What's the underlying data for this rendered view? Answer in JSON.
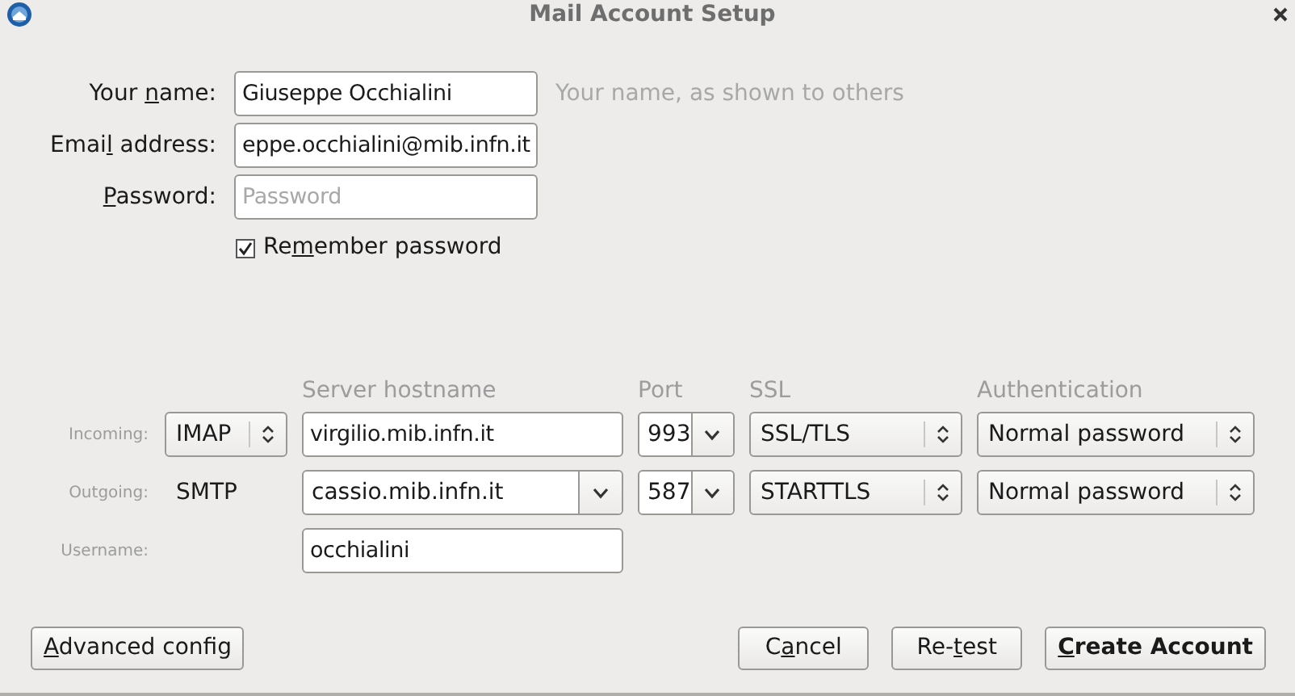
{
  "window": {
    "title": "Mail Account Setup"
  },
  "identity": [
    {
      "label": {
        "before": "Your ",
        "key": "n",
        "after": "ame:"
      },
      "value": "Giuseppe Occhialini",
      "hint": "Your name, as shown to others"
    },
    {
      "label": {
        "before": "Emai",
        "key": "l",
        "after": " address:"
      },
      "value": "eppe.occhialini@mib.infn.it"
    },
    {
      "label": {
        "key": "P",
        "after": "assword:"
      },
      "placeholder": "Password"
    }
  ],
  "remember_password": {
    "label": {
      "before": "Re",
      "key": "m",
      "after": "ember password"
    },
    "checked": true
  },
  "server_columns": [
    "Server hostname",
    "Port",
    "SSL",
    "Authentication"
  ],
  "servers": [
    {
      "label": "Incoming:",
      "protocol": {
        "kind": "select",
        "value": "IMAP"
      },
      "hostname": {
        "kind": "text",
        "value": "virgilio.mib.infn.it"
      },
      "port": "993",
      "ssl": "SSL/TLS",
      "auth": "Normal password"
    },
    {
      "label": "Outgoing:",
      "protocol": {
        "kind": "text",
        "value": "SMTP"
      },
      "hostname": {
        "kind": "combo",
        "value": "cassio.mib.infn.it"
      },
      "port": "587",
      "ssl": "STARTTLS",
      "auth": "Normal password"
    }
  ],
  "username": {
    "label": "Username:",
    "value": "occhialini"
  },
  "left_buttons": [
    {
      "label": {
        "key": "A",
        "after": "dvanced config"
      },
      "default": false
    }
  ],
  "right_buttons": [
    {
      "label": {
        "before": "C",
        "key": "a",
        "after": "ncel"
      },
      "default": false
    },
    {
      "label": {
        "before": "Re-",
        "key": "t",
        "after": "est"
      },
      "default": false
    },
    {
      "label": {
        "key": "C",
        "after": "reate Account"
      },
      "default": true
    }
  ]
}
